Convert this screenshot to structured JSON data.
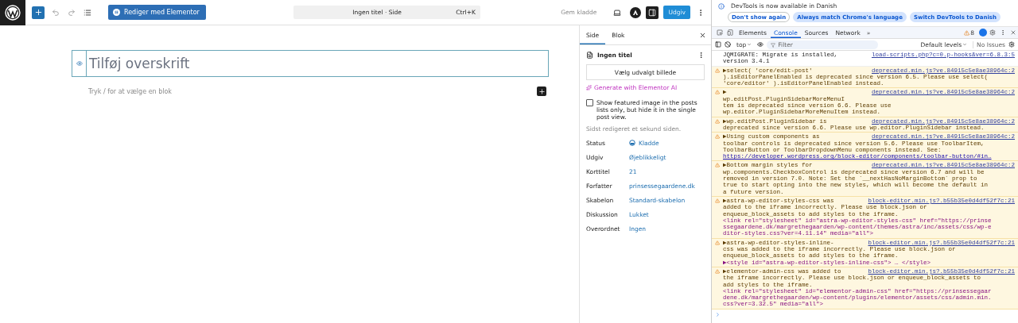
{
  "editor": {
    "toolbar": {
      "elementor_button": "Rediger med Elementor",
      "command_bar": {
        "title": "Ingen titel · Side",
        "shortcut": "Ctrl+K"
      },
      "save_draft": "Gem kladde",
      "settings_toggle": {
        "pressed": true
      },
      "publish": "Udgiv"
    },
    "canvas": {
      "title_placeholder": "Tilføj overskrift",
      "block_hint": "Tryk / for at vælge en blok"
    },
    "sidebar": {
      "tabs": [
        {
          "label": "Side",
          "selected": true
        },
        {
          "label": "Blok",
          "selected": false
        }
      ],
      "document_title": "Ingen titel",
      "featured_image_button": "Vælg udvalgt billede",
      "ai_link": "Generate with Elementor AI",
      "featured_checkbox": {
        "label": "Show featured image in the posts lists only, but hide it in the single post view.",
        "checked": false
      },
      "last_edited": "Sidst redigeret et sekund siden.",
      "fields": [
        {
          "label": "Status",
          "value": "Kladde",
          "kind": "status"
        },
        {
          "label": "Udgiv",
          "value": "Øjeblikkeligt",
          "kind": "link"
        },
        {
          "label": "Korttitel",
          "value": "21",
          "kind": "link"
        },
        {
          "label": "Forfatter",
          "value": "prinsessegaardene.dk",
          "kind": "link"
        },
        {
          "label": "Skabelon",
          "value": "Standard-skabelon",
          "kind": "link"
        },
        {
          "label": "Diskussion",
          "value": "Lukket",
          "kind": "link"
        },
        {
          "label": "Overordnet",
          "value": "Ingen",
          "kind": "link"
        }
      ]
    }
  },
  "devtools": {
    "notice": {
      "text": "DevTools is now available in Danish",
      "buttons": [
        "Don't show again",
        "Always match Chrome's language",
        "Switch DevTools to Danish"
      ]
    },
    "tabs": [
      {
        "label": "Elements",
        "selected": false
      },
      {
        "label": "Console",
        "selected": true
      },
      {
        "label": "Sources",
        "selected": false
      },
      {
        "label": "Network",
        "selected": false
      }
    ],
    "more_tabs": "»",
    "warning_count": "8",
    "filter_bar": {
      "context": "top",
      "placeholder": "Filter",
      "levels": "Default levels",
      "issues": "No Issues"
    },
    "messages": [
      {
        "kind": "log",
        "lines": [
          "JQMIGRATE: Migrate is installed,",
          "version 3.4.1"
        ],
        "source": "load-scripts.php?c=0.p-hooks&ver=6.8.3:5"
      },
      {
        "kind": "warning",
        "lines": [
          "▶select( 'core/edit-post'",
          ").isEditorPanelEnabled is deprecated since version 6.5. Please use select(",
          "'core/editor' ).isEditorPanelEnabled instead."
        ],
        "source": "deprecated.min.js?ve.84915c5e8ae38964c:2"
      },
      {
        "kind": "warning",
        "lines": [
          "▶",
          "wp.editPost.PluginSidebarMoreMenuI",
          "tem is deprecated since version 6.6. Please use",
          "wp.editor.PluginSidebarMoreMenuItem instead."
        ],
        "source": "deprecated.min.js?ve.84915c5e8ae38964c:2"
      },
      {
        "kind": "warning",
        "lines": [
          "▶wp.editPost.PluginSidebar is",
          "deprecated since version 6.6. Please use wp.editor.PluginSidebar instead."
        ],
        "source": "deprecated.min.js?ve.84915c5e8ae38964c:2"
      },
      {
        "kind": "warning",
        "lines": [
          "▶Using custom components as",
          "toolbar controls is deprecated since version 5.6. Please use ToolbarItem,",
          "ToolbarButton or ToolbarDropdownMenu components instead. See:"
        ],
        "link": "https://developer.wordpress.org/block-editor/components/toolbar-button/#in…",
        "source": "deprecated.min.js?ve.84915c5e8ae38964c:2"
      },
      {
        "kind": "warning",
        "lines": [
          "▶Bottom margin styles for",
          "wp.components.CheckboxControl is deprecated since version 6.7 and will be",
          "removed in version 7.0. Note: Set the `__nextHasNoMarginBottom` prop to",
          "true to start opting into the new styles, which will become the default in",
          "a future version."
        ],
        "source": "deprecated.min.js?ve.84915c5e8ae38964c:2"
      },
      {
        "kind": "warning",
        "lines": [
          "▶astra-wp-editor-styles-css was",
          "added to the iframe incorrectly. Please use block.json or",
          "enqueue_block_assets to add styles to the iframe."
        ],
        "code": [
          "<link rel=\"stylesheet\" id=\"astra-wp-editor-styles-css\" href=\"https://prinse",
          "ssegaardene.dk/margrethegaarden/wp-content/themes/astra/inc/assets/css/wp-e",
          "ditor-styles.css?ver=4.11.14\" media=\"all\">"
        ],
        "source": "block-editor.min.js?.b55b35e0d4df52f7c:21"
      },
      {
        "kind": "warning",
        "lines": [
          "▶astra-wp-editor-styles-inline-",
          "css was added to the iframe incorrectly. Please use block.json or",
          "enqueue_block_assets to add styles to the iframe."
        ],
        "code": [
          "▶<style id=\"astra-wp-editor-styles-inline-css\"> … </style>"
        ],
        "source": "block-editor.min.js?.b55b35e0d4df52f7c:21"
      },
      {
        "kind": "warning",
        "lines": [
          "▶elementor-admin-css was added to",
          "the iframe incorrectly. Please use block.json or enqueue_block_assets to",
          "add styles to the iframe."
        ],
        "code": [
          "<link rel=\"stylesheet\" id=\"elementor-admin-css\" href=\"https://prinsessegaar",
          "dene.dk/margrethegaarden/wp-content/plugins/elementor/assets/css/admin.min.",
          "css?ver=3.32.5\" media=\"all\">"
        ],
        "source": "block-editor.min.js?.b55b35e0d4df52f7c:21"
      }
    ]
  }
}
